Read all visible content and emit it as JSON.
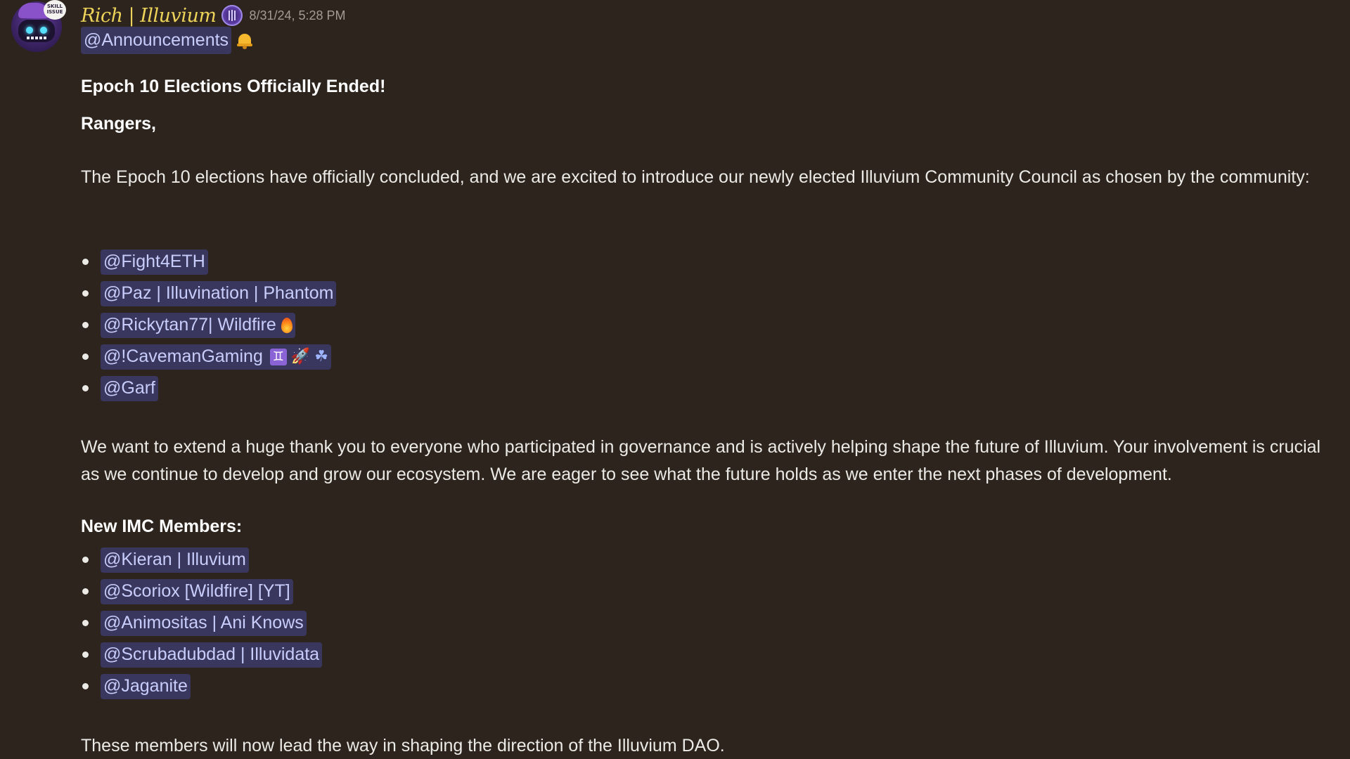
{
  "message": {
    "author": "Rich | Illuvium",
    "avatar_badge": "SKILL ISSUE",
    "timestamp": "8/31/24, 5:28 PM",
    "top_mention": "@Announcements",
    "title": "Epoch 10 Elections Officially Ended!",
    "greeting": "Rangers,",
    "intro": "The Epoch 10 elections have officially concluded, and we are excited to introduce our newly elected Illuvium Community Council as chosen by the community:",
    "council": [
      {
        "name": "@Fight4ETH"
      },
      {
        "name": "@Paz | Illuvination | Phantom"
      },
      {
        "name": "@Rickytan77| Wildfire"
      },
      {
        "name": "@!CavemanGaming"
      },
      {
        "name": "@Garf"
      }
    ],
    "thanks": "We want to extend a huge thank you to everyone who participated in governance and is actively helping shape the future of Illuvium. Your involvement is crucial as we continue to develop and grow our ecosystem. We are eager to see what the future holds as we enter the next phases of development.",
    "imc_heading": "New IMC Members:",
    "imc_members": [
      {
        "name": "@Kieran | Illuvium"
      },
      {
        "name": "@Scoriox [Wildfire] [YT]"
      },
      {
        "name": "@Animositas | Ani Knows"
      },
      {
        "name": "@Scrubadubdad | Illuvidata"
      },
      {
        "name": "@Jaganite"
      }
    ],
    "closing": "These members will now lead the way in shaping the direction of the Illuvium DAO."
  },
  "emoji": {
    "bell": "bell-emoji",
    "fire": "fire-emoji",
    "gemini": "♊",
    "rocket": "🚀",
    "clover": "☘"
  },
  "colors": {
    "background": "#2c241d",
    "author": "#eed35a",
    "mention_bg": "rgba(88,101,242,0.30)",
    "mention_text": "#c9cdfb"
  }
}
